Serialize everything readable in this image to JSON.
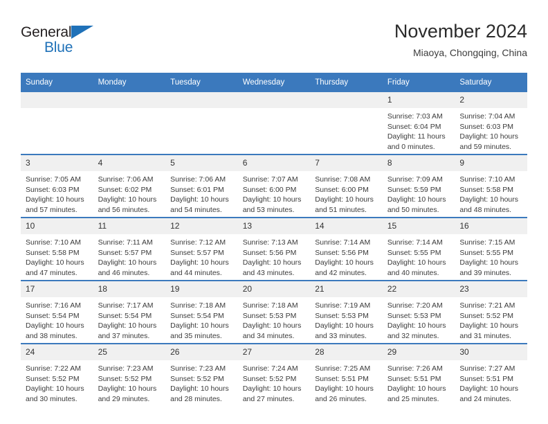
{
  "brand": {
    "name_part1": "General",
    "name_part2": "Blue",
    "triangle_icon": "triangle-icon",
    "color_blue": "#1f71b8",
    "color_dark": "#231f20"
  },
  "header": {
    "title": "November 2024",
    "location": "Miaoya, Chongqing, China"
  },
  "theme": {
    "header_blue": "#3b79bd",
    "daynum_bg": "#f0f0f0",
    "text": "#3a3a3a"
  },
  "weekdays": [
    "Sunday",
    "Monday",
    "Tuesday",
    "Wednesday",
    "Thursday",
    "Friday",
    "Saturday"
  ],
  "weeks": [
    [
      {
        "day": "",
        "blank": true
      },
      {
        "day": "",
        "blank": true
      },
      {
        "day": "",
        "blank": true
      },
      {
        "day": "",
        "blank": true
      },
      {
        "day": "",
        "blank": true
      },
      {
        "day": "1",
        "sunrise": "Sunrise: 7:03 AM",
        "sunset": "Sunset: 6:04 PM",
        "daylight_l1": "Daylight: 11 hours",
        "daylight_l2": "and 0 minutes."
      },
      {
        "day": "2",
        "sunrise": "Sunrise: 7:04 AM",
        "sunset": "Sunset: 6:03 PM",
        "daylight_l1": "Daylight: 10 hours",
        "daylight_l2": "and 59 minutes."
      }
    ],
    [
      {
        "day": "3",
        "sunrise": "Sunrise: 7:05 AM",
        "sunset": "Sunset: 6:03 PM",
        "daylight_l1": "Daylight: 10 hours",
        "daylight_l2": "and 57 minutes."
      },
      {
        "day": "4",
        "sunrise": "Sunrise: 7:06 AM",
        "sunset": "Sunset: 6:02 PM",
        "daylight_l1": "Daylight: 10 hours",
        "daylight_l2": "and 56 minutes."
      },
      {
        "day": "5",
        "sunrise": "Sunrise: 7:06 AM",
        "sunset": "Sunset: 6:01 PM",
        "daylight_l1": "Daylight: 10 hours",
        "daylight_l2": "and 54 minutes."
      },
      {
        "day": "6",
        "sunrise": "Sunrise: 7:07 AM",
        "sunset": "Sunset: 6:00 PM",
        "daylight_l1": "Daylight: 10 hours",
        "daylight_l2": "and 53 minutes."
      },
      {
        "day": "7",
        "sunrise": "Sunrise: 7:08 AM",
        "sunset": "Sunset: 6:00 PM",
        "daylight_l1": "Daylight: 10 hours",
        "daylight_l2": "and 51 minutes."
      },
      {
        "day": "8",
        "sunrise": "Sunrise: 7:09 AM",
        "sunset": "Sunset: 5:59 PM",
        "daylight_l1": "Daylight: 10 hours",
        "daylight_l2": "and 50 minutes."
      },
      {
        "day": "9",
        "sunrise": "Sunrise: 7:10 AM",
        "sunset": "Sunset: 5:58 PM",
        "daylight_l1": "Daylight: 10 hours",
        "daylight_l2": "and 48 minutes."
      }
    ],
    [
      {
        "day": "10",
        "sunrise": "Sunrise: 7:10 AM",
        "sunset": "Sunset: 5:58 PM",
        "daylight_l1": "Daylight: 10 hours",
        "daylight_l2": "and 47 minutes."
      },
      {
        "day": "11",
        "sunrise": "Sunrise: 7:11 AM",
        "sunset": "Sunset: 5:57 PM",
        "daylight_l1": "Daylight: 10 hours",
        "daylight_l2": "and 46 minutes."
      },
      {
        "day": "12",
        "sunrise": "Sunrise: 7:12 AM",
        "sunset": "Sunset: 5:57 PM",
        "daylight_l1": "Daylight: 10 hours",
        "daylight_l2": "and 44 minutes."
      },
      {
        "day": "13",
        "sunrise": "Sunrise: 7:13 AM",
        "sunset": "Sunset: 5:56 PM",
        "daylight_l1": "Daylight: 10 hours",
        "daylight_l2": "and 43 minutes."
      },
      {
        "day": "14",
        "sunrise": "Sunrise: 7:14 AM",
        "sunset": "Sunset: 5:56 PM",
        "daylight_l1": "Daylight: 10 hours",
        "daylight_l2": "and 42 minutes."
      },
      {
        "day": "15",
        "sunrise": "Sunrise: 7:14 AM",
        "sunset": "Sunset: 5:55 PM",
        "daylight_l1": "Daylight: 10 hours",
        "daylight_l2": "and 40 minutes."
      },
      {
        "day": "16",
        "sunrise": "Sunrise: 7:15 AM",
        "sunset": "Sunset: 5:55 PM",
        "daylight_l1": "Daylight: 10 hours",
        "daylight_l2": "and 39 minutes."
      }
    ],
    [
      {
        "day": "17",
        "sunrise": "Sunrise: 7:16 AM",
        "sunset": "Sunset: 5:54 PM",
        "daylight_l1": "Daylight: 10 hours",
        "daylight_l2": "and 38 minutes."
      },
      {
        "day": "18",
        "sunrise": "Sunrise: 7:17 AM",
        "sunset": "Sunset: 5:54 PM",
        "daylight_l1": "Daylight: 10 hours",
        "daylight_l2": "and 37 minutes."
      },
      {
        "day": "19",
        "sunrise": "Sunrise: 7:18 AM",
        "sunset": "Sunset: 5:54 PM",
        "daylight_l1": "Daylight: 10 hours",
        "daylight_l2": "and 35 minutes."
      },
      {
        "day": "20",
        "sunrise": "Sunrise: 7:18 AM",
        "sunset": "Sunset: 5:53 PM",
        "daylight_l1": "Daylight: 10 hours",
        "daylight_l2": "and 34 minutes."
      },
      {
        "day": "21",
        "sunrise": "Sunrise: 7:19 AM",
        "sunset": "Sunset: 5:53 PM",
        "daylight_l1": "Daylight: 10 hours",
        "daylight_l2": "and 33 minutes."
      },
      {
        "day": "22",
        "sunrise": "Sunrise: 7:20 AM",
        "sunset": "Sunset: 5:53 PM",
        "daylight_l1": "Daylight: 10 hours",
        "daylight_l2": "and 32 minutes."
      },
      {
        "day": "23",
        "sunrise": "Sunrise: 7:21 AM",
        "sunset": "Sunset: 5:52 PM",
        "daylight_l1": "Daylight: 10 hours",
        "daylight_l2": "and 31 minutes."
      }
    ],
    [
      {
        "day": "24",
        "sunrise": "Sunrise: 7:22 AM",
        "sunset": "Sunset: 5:52 PM",
        "daylight_l1": "Daylight: 10 hours",
        "daylight_l2": "and 30 minutes."
      },
      {
        "day": "25",
        "sunrise": "Sunrise: 7:23 AM",
        "sunset": "Sunset: 5:52 PM",
        "daylight_l1": "Daylight: 10 hours",
        "daylight_l2": "and 29 minutes."
      },
      {
        "day": "26",
        "sunrise": "Sunrise: 7:23 AM",
        "sunset": "Sunset: 5:52 PM",
        "daylight_l1": "Daylight: 10 hours",
        "daylight_l2": "and 28 minutes."
      },
      {
        "day": "27",
        "sunrise": "Sunrise: 7:24 AM",
        "sunset": "Sunset: 5:52 PM",
        "daylight_l1": "Daylight: 10 hours",
        "daylight_l2": "and 27 minutes."
      },
      {
        "day": "28",
        "sunrise": "Sunrise: 7:25 AM",
        "sunset": "Sunset: 5:51 PM",
        "daylight_l1": "Daylight: 10 hours",
        "daylight_l2": "and 26 minutes."
      },
      {
        "day": "29",
        "sunrise": "Sunrise: 7:26 AM",
        "sunset": "Sunset: 5:51 PM",
        "daylight_l1": "Daylight: 10 hours",
        "daylight_l2": "and 25 minutes."
      },
      {
        "day": "30",
        "sunrise": "Sunrise: 7:27 AM",
        "sunset": "Sunset: 5:51 PM",
        "daylight_l1": "Daylight: 10 hours",
        "daylight_l2": "and 24 minutes."
      }
    ]
  ]
}
